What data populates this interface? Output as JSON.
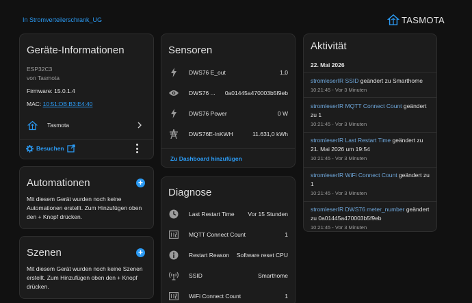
{
  "breadcrumb": "In Stromverteilerschrank_UG",
  "brand": {
    "name": "TASMOTA"
  },
  "device_info": {
    "title": "Geräte-Informationen",
    "model": "ESP32C3",
    "manufacturer": "von Tasmota",
    "firmware": "Firmware: 15.0.1.4",
    "mac_label": "MAC: ",
    "mac_value": "10:51:DB:B3:E4:40",
    "integration": "Tasmota",
    "search_label": "Besuchen"
  },
  "automations": {
    "title": "Automationen",
    "text": "Mit diesem Gerät wurden noch keine Automationen erstellt. Zum Hinzufügen oben den + Knopf drücken."
  },
  "scenes": {
    "title": "Szenen",
    "text": "Mit diesem Gerät wurden noch keine Szenen erstellt. Zum Hinzufügen oben den + Knopf drücken."
  },
  "sensors": {
    "title": "Sensoren",
    "rows": [
      {
        "name": "DWS76 E_out",
        "value": "1,0",
        "icon": "flash-icon"
      },
      {
        "name": "DWS76 ...",
        "value": "0a01445a470003b5f9eb",
        "icon": "eye-icon"
      },
      {
        "name": "DWS76 Power",
        "value": "0 W",
        "icon": "flash-icon"
      },
      {
        "name": "DWS76E-InKWH",
        "value": "11.631,0 kWh",
        "icon": "transmission-tower-icon"
      }
    ],
    "dashboard_link": "Zu Dashboard hinzufügen"
  },
  "diagnostics": {
    "title": "Diagnose",
    "rows": [
      {
        "name": "Last Restart Time",
        "value": "Vor 15 Stunden",
        "icon": "clock-icon"
      },
      {
        "name": "MQTT Connect Count",
        "value": "1",
        "icon": "counter-icon"
      },
      {
        "name": "Restart Reason",
        "value": "Software reset CPU",
        "icon": "info-icon"
      },
      {
        "name": "SSID",
        "value": "Smarthome",
        "icon": "wifi-antenna-icon"
      },
      {
        "name": "WiFi Connect Count",
        "value": "1",
        "icon": "counter-icon"
      }
    ]
  },
  "activity": {
    "title": "Aktivität",
    "date": "22. Mai 2026",
    "items": [
      {
        "entity": "stromleserIR SSID",
        "text": " geändert zu Smarthome",
        "time": "10:21:45 - Vor 3 Minuten"
      },
      {
        "entity": "stromleserIR MQTT Connect Count",
        "text": " geändert zu 1",
        "time": "10:21:45 - Vor 3 Minuten"
      },
      {
        "entity": "stromleserIR Last Restart Time",
        "text": " geändert zu 21. Mai 2026 um 19:54",
        "time": "10:21:45 - Vor 3 Minuten"
      },
      {
        "entity": "stromleserIR WiFi Connect Count",
        "text": " geändert zu 1",
        "time": "10:21:45 - Vor 3 Minuten"
      },
      {
        "entity": "stromleserIR DWS76 meter_number",
        "text": " geändert zu 0a01445a470003b5f9eb",
        "time": "10:21:45 - Vor 3 Minuten"
      }
    ]
  },
  "colors": {
    "accent": "#2b9af3",
    "card": "#1c1c1c",
    "background": "#111111",
    "icon": "#9b9b9b"
  }
}
